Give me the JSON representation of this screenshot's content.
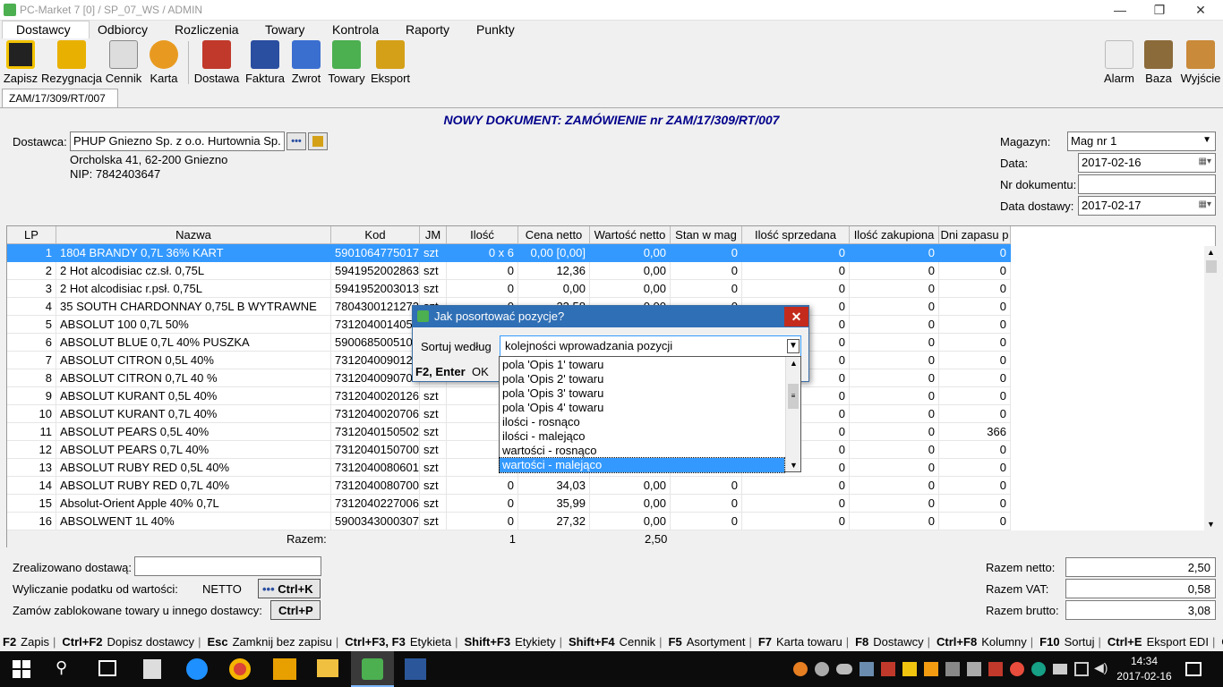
{
  "window": {
    "title": "PC-Market 7 [0] / SP_07_WS / ADMIN",
    "controls": [
      "—",
      "❐",
      "✕"
    ]
  },
  "menu": [
    "Dostawcy",
    "Odbiorcy",
    "Rozliczenia",
    "Towary",
    "Kontrola",
    "Raporty",
    "Punkty"
  ],
  "toolbar": {
    "left": [
      "Zapisz",
      "Rezygnacja",
      "Cennik",
      "Karta",
      "Dostawa",
      "Faktura",
      "Zwrot",
      "Towary",
      "Eksport"
    ],
    "right": [
      "Alarm",
      "Baza",
      "Wyjście"
    ]
  },
  "doc_tab": "ZAM/17/309/RT/007",
  "doc_title": "NOWY DOKUMENT: ZAMÓWIENIE nr ZAM/17/309/RT/007",
  "supplier": {
    "label": "Dostawca:",
    "name": "PHUP Gniezno Sp. z o.o. Hurtownia Sp.",
    "address": "Orcholska 41, 62-200 Gniezno",
    "nip": "NIP: 7842403647",
    "dots_btn": "•••"
  },
  "right_fields": {
    "magazyn_label": "Magazyn:",
    "magazyn": "Mag nr 1",
    "data_label": "Data:",
    "data": "2017-02-16",
    "nr_label": "Nr dokumentu:",
    "nr": "",
    "data_dost_label": "Data dostawy:",
    "data_dost": "2017-02-17"
  },
  "grid": {
    "columns": [
      "LP",
      "Nazwa",
      "Kod",
      "JM",
      "Ilość",
      "Cena netto",
      "Wartość netto",
      "Stan w mag",
      "Ilość sprzedana",
      "Ilość zakupiona",
      "Dni zapasu p"
    ],
    "rows": [
      [
        "1",
        "1804 BRANDY 0,7L 36% KART",
        "5901064775017",
        "szt",
        "0 x 6",
        "0,00 [0,00]",
        "0,00",
        "0",
        "0",
        "0",
        "0"
      ],
      [
        "2",
        "2 Hot alcodisiac cz.sł. 0,75L",
        "5941952002863",
        "szt",
        "0",
        "12,36",
        "0,00",
        "0",
        "0",
        "0",
        "0"
      ],
      [
        "3",
        "2 Hot alcodisiac r.psł. 0,75L",
        "5941952003013",
        "szt",
        "0",
        "0,00",
        "0,00",
        "0",
        "0",
        "0",
        "0"
      ],
      [
        "4",
        "35 SOUTH CHARDONNAY 0,75L B WYTRAWNE",
        "7804300121273",
        "szt",
        "0",
        "23,58",
        "0,00",
        "0",
        "0",
        "0",
        "0"
      ],
      [
        "5",
        "ABSOLUT 100 0,7L 50%",
        "7312040014057",
        "szt",
        "",
        "",
        "",
        "",
        "0",
        "0",
        "0"
      ],
      [
        "6",
        "ABSOLUT BLUE 0,7L 40% PUSZKA",
        "5900685005107",
        "szt",
        "",
        "",
        "",
        "",
        "0",
        "0",
        "0"
      ],
      [
        "7",
        "ABSOLUT CITRON 0,5L 40%",
        "7312040090129",
        "szt",
        "",
        "",
        "",
        "",
        "0",
        "0",
        "0"
      ],
      [
        "8",
        "ABSOLUT CITRON 0,7L 40 %",
        "7312040090709",
        "szt",
        "",
        "",
        "",
        "",
        "0",
        "0",
        "0"
      ],
      [
        "9",
        "ABSOLUT KURANT 0,5L 40%",
        "7312040020126",
        "szt",
        "",
        "",
        "",
        "",
        "0",
        "0",
        "0"
      ],
      [
        "10",
        "ABSOLUT KURANT 0,7L 40%",
        "7312040020706",
        "szt",
        "",
        "",
        "",
        "",
        "0",
        "0",
        "0"
      ],
      [
        "11",
        "ABSOLUT PEARS 0,5L 40%",
        "7312040150502",
        "szt",
        "",
        "",
        "",
        "",
        "0",
        "0",
        "366"
      ],
      [
        "12",
        "ABSOLUT PEARS 0,7L 40%",
        "7312040150700",
        "szt",
        "",
        "",
        "",
        "",
        "0",
        "0",
        "0"
      ],
      [
        "13",
        "ABSOLUT RUBY RED 0,5L 40%",
        "7312040080601",
        "szt",
        "",
        "",
        "",
        "",
        "0",
        "0",
        "0"
      ],
      [
        "14",
        "ABSOLUT RUBY RED 0,7L 40%",
        "7312040080700",
        "szt",
        "0",
        "34,03",
        "0,00",
        "0",
        "0",
        "0",
        "0"
      ],
      [
        "15",
        "Absolut-Orient Apple 40% 0,7L",
        "7312040227006",
        "szt",
        "0",
        "35,99",
        "0,00",
        "0",
        "0",
        "0",
        "0"
      ],
      [
        "16",
        "ABSOLWENT 1L 40%",
        "5900343000307",
        "szt",
        "0",
        "27,32",
        "0,00",
        "0",
        "0",
        "0",
        "0"
      ]
    ],
    "razem_label": "Razem:",
    "razem_ilosc": "1",
    "razem_wartosc": "2,50"
  },
  "bottom": {
    "zreal_label": "Zrealizowano dostawą:",
    "zreal_value": "",
    "wylicz_label": "Wyliczanie podatku od wartości:",
    "wylicz_value": "NETTO",
    "ctrlk": "Ctrl+K",
    "zamow_label": "Zamów zablokowane towary u innego dostawcy:",
    "ctrlp": "Ctrl+P",
    "netto_label": "Razem netto:",
    "netto": "2,50",
    "vat_label": "Razem VAT:",
    "vat": "0,58",
    "brutto_label": "Razem brutto:",
    "brutto": "3,08"
  },
  "fkeys": [
    [
      "F2",
      "Zapis"
    ],
    [
      "Ctrl+F2",
      "Dopisz dostawcy"
    ],
    [
      "Esc",
      "Zamknij bez zapisu"
    ],
    [
      "Ctrl+F3, F3",
      "Etykieta"
    ],
    [
      "Shift+F3",
      "Etykiety"
    ],
    [
      "Shift+F4",
      "Cennik"
    ],
    [
      "F5",
      "Asortyment"
    ],
    [
      "F7",
      "Karta towaru"
    ],
    [
      "F8",
      "Dostawcy"
    ],
    [
      "Ctrl+F8",
      "Kolumny"
    ],
    [
      "F10",
      "Sortuj"
    ],
    [
      "Ctrl+E",
      "Eksport EDI"
    ],
    [
      "Ctrl+I",
      ""
    ]
  ],
  "dialog": {
    "title": "Jak posortować pozycje?",
    "sort_label": "Sortuj według",
    "selected": "kolejności wprowadzania pozycji",
    "ok_hint": "F2, Enter",
    "ok": "OK",
    "options": [
      "pola 'Opis 1' towaru",
      "pola 'Opis 2' towaru",
      "pola 'Opis 3' towaru",
      "pola 'Opis 4' towaru",
      "ilości - rosnąco",
      "ilości - malejąco",
      "wartości - rosnąco",
      "wartości - malejąco"
    ],
    "highlighted_index": 7
  },
  "taskbar": {
    "time": "14:34",
    "date": "2017-02-16"
  },
  "colors": {
    "selection": "#3399ff",
    "title_blue": "#00008b",
    "dialog_title": "#2f6fb5",
    "taskbar": "#0c0c0c"
  }
}
